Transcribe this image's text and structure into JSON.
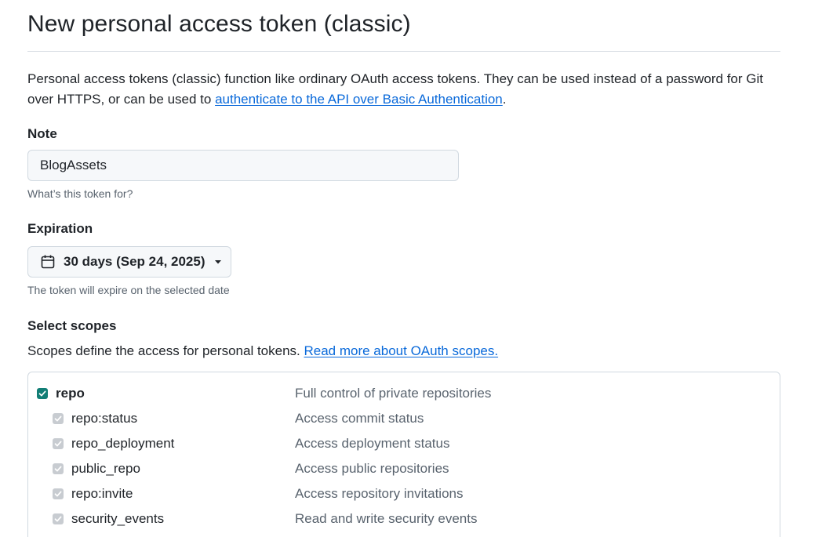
{
  "page": {
    "title": "New personal access token (classic)"
  },
  "intro": {
    "text": "Personal access tokens (classic) function like ordinary OAuth access tokens. They can be used instead of a password for Git over HTTPS, or can be used to ",
    "link_text": "authenticate to the API over Basic Authentication",
    "trailing": "."
  },
  "note": {
    "label": "Note",
    "value": "BlogAssets",
    "hint": "What’s this token for?"
  },
  "expiration": {
    "label": "Expiration",
    "selected": "30 days (Sep 24, 2025)",
    "hint": "The token will expire on the selected date",
    "icon": "calendar-icon"
  },
  "scopes": {
    "label": "Select scopes",
    "description": "Scopes define the access for personal tokens. ",
    "link_text": "Read more about OAuth scopes.",
    "items": [
      {
        "name": "repo",
        "description": "Full control of private repositories",
        "checked": true,
        "child": false
      },
      {
        "name": "repo:status",
        "description": "Access commit status",
        "checked": true,
        "child": true
      },
      {
        "name": "repo_deployment",
        "description": "Access deployment status",
        "checked": true,
        "child": true
      },
      {
        "name": "public_repo",
        "description": "Access public repositories",
        "checked": true,
        "child": true
      },
      {
        "name": "repo:invite",
        "description": "Access repository invitations",
        "checked": true,
        "child": true
      },
      {
        "name": "security_events",
        "description": "Read and write security events",
        "checked": true,
        "child": true
      }
    ]
  },
  "colors": {
    "link": "#0969da",
    "checkbox_checked": "#127e76",
    "checkbox_disabled": "#c8ccd1",
    "muted_text": "#59636e"
  }
}
